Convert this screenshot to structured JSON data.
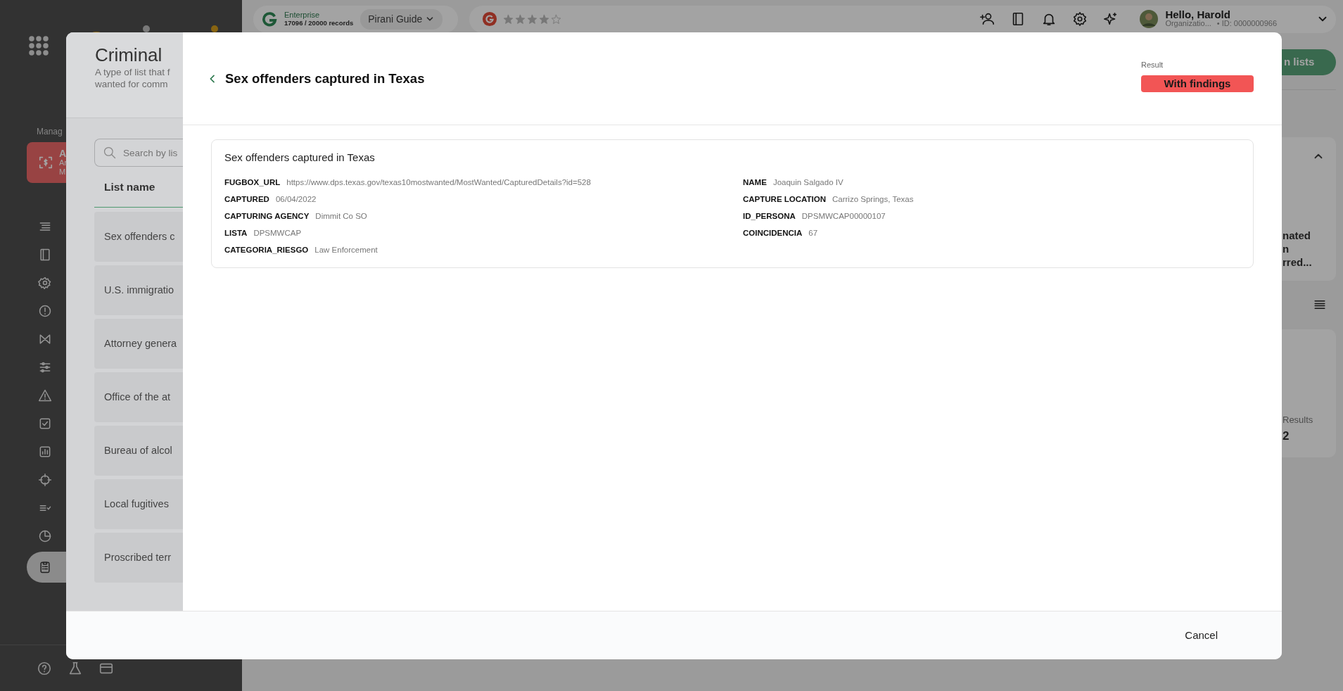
{
  "sidebar": {
    "section_label": "Manag",
    "active_card": {
      "title": "A",
      "lines": [
        "Ar",
        "M"
      ]
    },
    "nav_items": [
      {
        "selected": false
      },
      {
        "selected": false
      },
      {
        "selected": false
      },
      {
        "selected": false
      },
      {
        "selected": false
      },
      {
        "selected": false
      },
      {
        "selected": false
      },
      {
        "selected": false
      },
      {
        "selected": false
      },
      {
        "selected": false
      },
      {
        "selected": false
      },
      {
        "selected": false
      },
      {
        "selected": true
      }
    ]
  },
  "top_bar": {
    "plan": "Enterprise",
    "records": "17096 / 20000 records",
    "guide": "Pirani Guide",
    "rating": {
      "stars": 4
    },
    "greeting": "Hello, Harold",
    "organization": "Organizatio...",
    "user_id": "• ID: 0000000966"
  },
  "background_page": {
    "button": "n lists",
    "card_lines": [
      "nated",
      "n",
      "rred..."
    ],
    "stat_label": "Results",
    "stat_value": "2"
  },
  "list_dialog": {
    "title": "Criminal",
    "description_lines": [
      "A type of list that f",
      "wanted for comm"
    ],
    "search": {
      "placeholder": "Search by lis"
    },
    "column": "List name",
    "rows": [
      "Sex offenders c",
      "U.S. immigratio",
      "Attorney genera",
      "Office of the at",
      "Bureau of alcol",
      "Local fugitives",
      "Proscribed terr"
    ]
  },
  "detail": {
    "title": "Sex offenders captured in Texas",
    "result_label": "Result",
    "result": "With findings",
    "card_title": "Sex offenders captured in Texas",
    "left_fields": [
      {
        "label": "FUGBOX_URL",
        "value": "https://www.dps.texas.gov/texas10mostwanted/MostWanted/CapturedDetails?id=528"
      },
      {
        "label": "CAPTURED",
        "value": "06/04/2022"
      },
      {
        "label": "CAPTURING AGENCY",
        "value": "Dimmit Co SO"
      },
      {
        "label": "LISTA",
        "value": "DPSMWCAP"
      },
      {
        "label": "CATEGORIA_RIESGO",
        "value": "Law Enforcement"
      }
    ],
    "right_fields": [
      {
        "label": "NAME",
        "value": "Joaquin Salgado IV"
      },
      {
        "label": "CAPTURE LOCATION",
        "value": "Carrizo Springs, Texas"
      },
      {
        "label": "ID_PERSONA",
        "value": "DPSMWCAP00000107"
      },
      {
        "label": "COINCIDENCIA",
        "value": "67"
      }
    ]
  },
  "footer": {
    "cancel": "Cancel"
  }
}
